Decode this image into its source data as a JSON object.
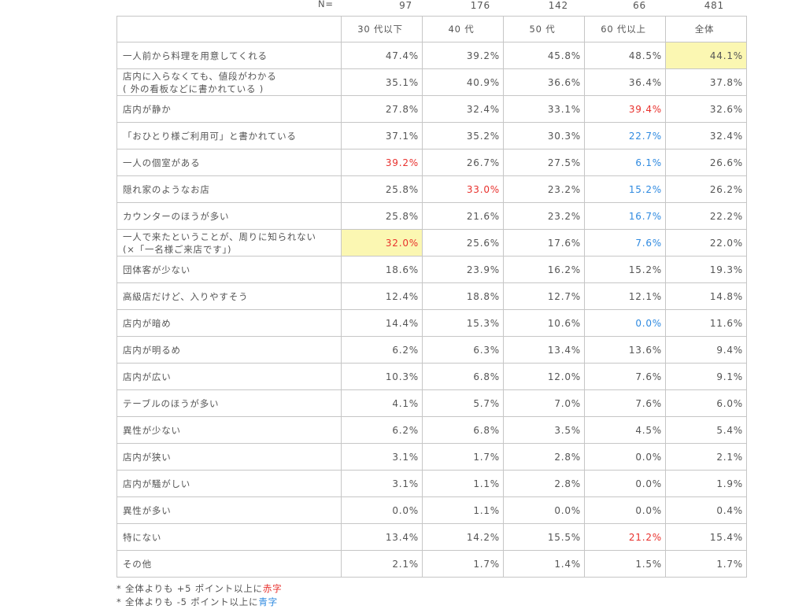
{
  "n_label": "N=",
  "n_values": [
    "97",
    "176",
    "142",
    "66",
    "481"
  ],
  "columns": [
    "30 代以下",
    "40 代",
    "50 代",
    "60 代以上",
    "全体"
  ],
  "rows": [
    {
      "label": [
        "一人前から料理を用意してくれる"
      ],
      "values": [
        "47.4%",
        "39.2%",
        "45.8%",
        "48.5%",
        "44.1%"
      ],
      "styles": [
        "",
        "",
        "",
        "",
        "hl"
      ]
    },
    {
      "label": [
        "店内に入らなくても、値段がわかる",
        "( 外の看板などに書かれている )"
      ],
      "values": [
        "35.1%",
        "40.9%",
        "36.6%",
        "36.4%",
        "37.8%"
      ],
      "styles": [
        "",
        "",
        "",
        "",
        ""
      ]
    },
    {
      "label": [
        "店内が静か"
      ],
      "values": [
        "27.8%",
        "32.4%",
        "33.1%",
        "39.4%",
        "32.6%"
      ],
      "styles": [
        "",
        "",
        "",
        "red",
        ""
      ]
    },
    {
      "label": [
        "「おひとり様ご利用可」と書かれている"
      ],
      "values": [
        "37.1%",
        "35.2%",
        "30.3%",
        "22.7%",
        "32.4%"
      ],
      "styles": [
        "",
        "",
        "",
        "blue",
        ""
      ]
    },
    {
      "label": [
        "一人の個室がある"
      ],
      "values": [
        "39.2%",
        "26.7%",
        "27.5%",
        "6.1%",
        "26.6%"
      ],
      "styles": [
        "red",
        "",
        "",
        "blue",
        ""
      ]
    },
    {
      "label": [
        "隠れ家のようなお店"
      ],
      "values": [
        "25.8%",
        "33.0%",
        "23.2%",
        "15.2%",
        "26.2%"
      ],
      "styles": [
        "",
        "red",
        "",
        "blue",
        ""
      ]
    },
    {
      "label": [
        "カウンターのほうが多い"
      ],
      "values": [
        "25.8%",
        "21.6%",
        "23.2%",
        "16.7%",
        "22.2%"
      ],
      "styles": [
        "",
        "",
        "",
        "blue",
        ""
      ]
    },
    {
      "label": [
        "一人で来たということが、周りに知られない",
        "(×「一名様ご来店です」)"
      ],
      "values": [
        "32.0%",
        "25.6%",
        "17.6%",
        "7.6%",
        "22.0%"
      ],
      "styles": [
        "red hl",
        "",
        "",
        "blue",
        ""
      ]
    },
    {
      "label": [
        "団体客が少ない"
      ],
      "values": [
        "18.6%",
        "23.9%",
        "16.2%",
        "15.2%",
        "19.3%"
      ],
      "styles": [
        "",
        "",
        "",
        "",
        ""
      ]
    },
    {
      "label": [
        "高級店だけど、入りやすそう"
      ],
      "values": [
        "12.4%",
        "18.8%",
        "12.7%",
        "12.1%",
        "14.8%"
      ],
      "styles": [
        "",
        "",
        "",
        "",
        ""
      ]
    },
    {
      "label": [
        "店内が暗め"
      ],
      "values": [
        "14.4%",
        "15.3%",
        "10.6%",
        "0.0%",
        "11.6%"
      ],
      "styles": [
        "",
        "",
        "",
        "blue",
        ""
      ]
    },
    {
      "label": [
        "店内が明るめ"
      ],
      "values": [
        "6.2%",
        "6.3%",
        "13.4%",
        "13.6%",
        "9.4%"
      ],
      "styles": [
        "",
        "",
        "",
        "",
        ""
      ]
    },
    {
      "label": [
        "店内が広い"
      ],
      "values": [
        "10.3%",
        "6.8%",
        "12.0%",
        "7.6%",
        "9.1%"
      ],
      "styles": [
        "",
        "",
        "",
        "",
        ""
      ]
    },
    {
      "label": [
        "テーブルのほうが多い"
      ],
      "values": [
        "4.1%",
        "5.7%",
        "7.0%",
        "7.6%",
        "6.0%"
      ],
      "styles": [
        "",
        "",
        "",
        "",
        ""
      ]
    },
    {
      "label": [
        "異性が少ない"
      ],
      "values": [
        "6.2%",
        "6.8%",
        "3.5%",
        "4.5%",
        "5.4%"
      ],
      "styles": [
        "",
        "",
        "",
        "",
        ""
      ]
    },
    {
      "label": [
        "店内が狭い"
      ],
      "values": [
        "3.1%",
        "1.7%",
        "2.8%",
        "0.0%",
        "2.1%"
      ],
      "styles": [
        "",
        "",
        "",
        "",
        ""
      ]
    },
    {
      "label": [
        "店内が騒がしい"
      ],
      "values": [
        "3.1%",
        "1.1%",
        "2.8%",
        "0.0%",
        "1.9%"
      ],
      "styles": [
        "",
        "",
        "",
        "",
        ""
      ]
    },
    {
      "label": [
        "異性が多い"
      ],
      "values": [
        "0.0%",
        "1.1%",
        "0.0%",
        "0.0%",
        "0.4%"
      ],
      "styles": [
        "",
        "",
        "",
        "",
        ""
      ]
    },
    {
      "label": [
        "特にない"
      ],
      "values": [
        "13.4%",
        "14.2%",
        "15.5%",
        "21.2%",
        "15.4%"
      ],
      "styles": [
        "",
        "",
        "",
        "red",
        ""
      ]
    },
    {
      "label": [
        "その他"
      ],
      "values": [
        "2.1%",
        "1.7%",
        "1.4%",
        "1.5%",
        "1.7%"
      ],
      "styles": [
        "",
        "",
        "",
        "",
        ""
      ]
    }
  ],
  "notes": [
    {
      "prefix": "* 全体よりも +5 ポイント以上に",
      "colored": "赤字",
      "color": "red"
    },
    {
      "prefix": "* 全体よりも -5 ポイント以上に",
      "colored": "青字",
      "color": "blue"
    }
  ],
  "colors": {
    "red": "#e8312d",
    "blue": "#2f8ae0",
    "highlight": "#fbf7b2"
  }
}
